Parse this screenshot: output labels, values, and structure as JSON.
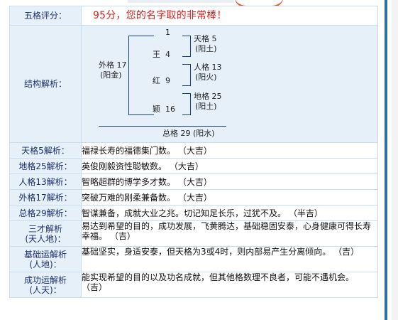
{
  "summary": {
    "label": "五格评分：",
    "value": "95分，您的名字取的非常棒！"
  },
  "structure": {
    "label": "结构解析：",
    "chars": [
      {
        "char": "",
        "num": "1"
      },
      {
        "char": "王",
        "num": "4"
      },
      {
        "char": "红",
        "num": "9"
      },
      {
        "char": "颖",
        "num": "16"
      }
    ],
    "outer": {
      "name": "外格 17",
      "element": "(阳金)"
    },
    "right_grids": [
      {
        "name": "天格 5",
        "element": "(阳土)"
      },
      {
        "name": "人格 13",
        "element": "(阳火)"
      },
      {
        "name": "地格 25",
        "element": "(阳土)"
      }
    ],
    "total": "总格 29 (阳水)"
  },
  "rows": [
    {
      "label": "天格5解析：",
      "text": "福禄长寿的福德集门数。 （大吉）"
    },
    {
      "label": "地格25解析：",
      "text": "英俊刚毅资性聪敏数。 （大吉）"
    },
    {
      "label": "人格13解析：",
      "text": "智略超群的博学多才数。 （大吉）"
    },
    {
      "label": "外格17解析：",
      "text": "突破万难的刚柔兼备数。 （大吉）"
    },
    {
      "label": "总格29解析：",
      "text": "智谋兼备，成就大业之兆。切记知足长乐，过犹不及。 （半吉）"
    }
  ],
  "multirows": [
    {
      "label_line1": "三才解析",
      "label_line2": "(天人地)：",
      "text": "易达到希望的目的，成功发展，飞黄腾达，基础稳固安泰，心身健康可得长寿幸福。 （吉）"
    },
    {
      "label_line1": "基础运解析",
      "label_line2": "(人地)：",
      "text": "基础坚实，身适安泰，但天格为3或4时，则内部易产生分离倾向。 （吉）"
    },
    {
      "label_line1": "成功运解析",
      "label_line2": "(人天)：",
      "text": "能实现希望的目的以及功名成就，但其他格数理不良者，可能不遇机会。 （吉）"
    }
  ]
}
